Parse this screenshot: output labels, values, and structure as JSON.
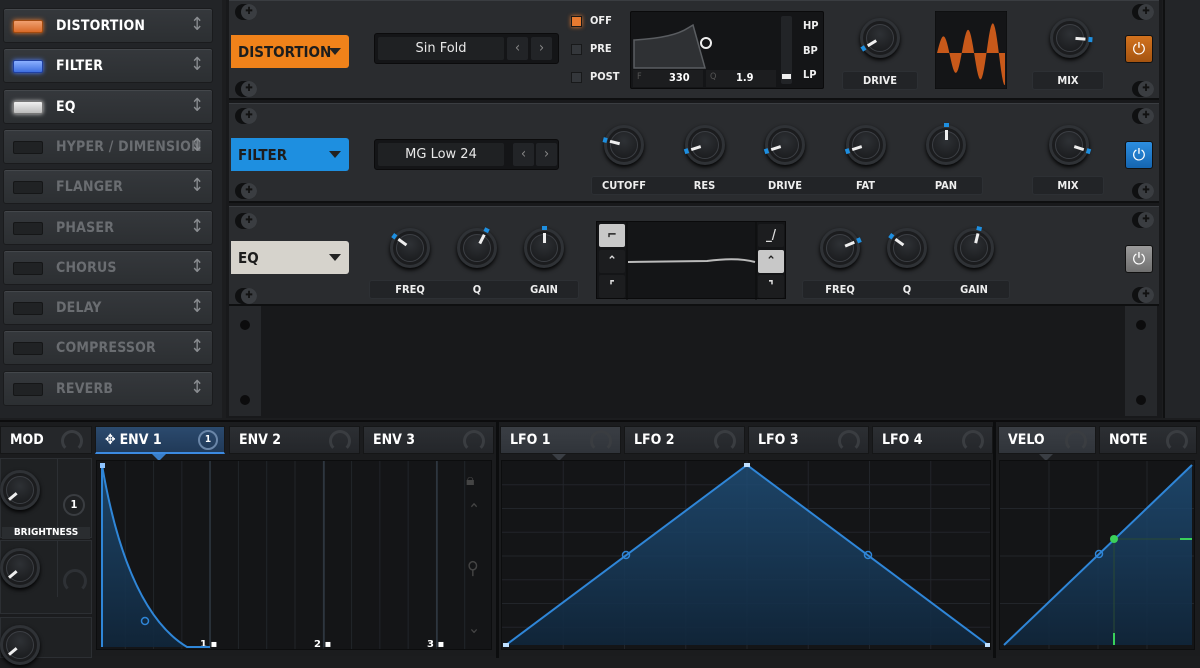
{
  "sidebar": {
    "items": [
      {
        "label": "DISTORTION",
        "state": "on",
        "led_color": "#e8792f"
      },
      {
        "label": "FILTER",
        "state": "on",
        "led_color": "#4f7df0"
      },
      {
        "label": "EQ",
        "state": "on",
        "led_color": "#dddddd"
      },
      {
        "label": "HYPER / DIMENSION",
        "state": "off"
      },
      {
        "label": "FLANGER",
        "state": "off"
      },
      {
        "label": "PHASER",
        "state": "off"
      },
      {
        "label": "CHORUS",
        "state": "off"
      },
      {
        "label": "DELAY",
        "state": "off"
      },
      {
        "label": "COMPRESSOR",
        "state": "off"
      },
      {
        "label": "REVERB",
        "state": "off"
      }
    ],
    "drag_icon": "↕"
  },
  "distortion": {
    "title": "DISTORTION",
    "color": "#f0821a",
    "preset": "Sin Fold",
    "prev": "‹",
    "next": "›",
    "routing": [
      {
        "label": "OFF",
        "checked": true
      },
      {
        "label": "PRE",
        "checked": false
      },
      {
        "label": "POST",
        "checked": false
      }
    ],
    "filter_display": {
      "f_label": "F",
      "f_value": "330",
      "q_label": "Q",
      "q_value": "1.9",
      "modes": [
        "HP",
        "BP",
        "LP"
      ],
      "selected_mode": "LP"
    },
    "knobs": [
      {
        "label": "DRIVE",
        "value": 0.05
      }
    ],
    "mix": {
      "label": "MIX",
      "value": 0.85
    },
    "power_icon": "⏻",
    "enabled": true
  },
  "filter": {
    "title": "FILTER",
    "color": "#1e8fe0",
    "preset": "MG Low 24",
    "prev": "‹",
    "next": "›",
    "knobs": [
      {
        "label": "CUTOFF",
        "value": 0.22
      },
      {
        "label": "RES",
        "value": 0.1
      },
      {
        "label": "DRIVE",
        "value": 0.1
      },
      {
        "label": "FAT",
        "value": 0.1
      },
      {
        "label": "PAN",
        "value": 0.5
      }
    ],
    "mix": {
      "label": "MIX",
      "value": 0.9
    },
    "power_icon": "⏻",
    "enabled": true
  },
  "eq": {
    "title": "EQ",
    "color": "#d6d3cc",
    "low": [
      {
        "label": "FREQ",
        "value": 0.3
      },
      {
        "label": "Q",
        "value": 0.6
      },
      {
        "label": "GAIN",
        "value": 0.5
      }
    ],
    "high": [
      {
        "label": "FREQ",
        "value": 0.75
      },
      {
        "label": "Q",
        "value": 0.3
      },
      {
        "label": "GAIN",
        "value": 0.55
      }
    ],
    "left_shapes": [
      "low-shelf",
      "peak",
      "high-pass"
    ],
    "right_shapes": [
      "high-shelf",
      "peak",
      "low-pass"
    ],
    "power_icon": "⏻",
    "enabled": true
  },
  "mod": {
    "header": "MOD",
    "source": {
      "label": "BRIGHTNESS",
      "count": "1"
    },
    "env_tabs": [
      {
        "label": "ENV 1",
        "active": true,
        "badge": "1"
      },
      {
        "label": "ENV 2",
        "active": false
      },
      {
        "label": "ENV 3",
        "active": false
      }
    ],
    "env_markers": [
      "1",
      "2",
      "3"
    ],
    "lfo_tabs": [
      {
        "label": "LFO 1",
        "selected": true
      },
      {
        "label": "LFO 2"
      },
      {
        "label": "LFO 3"
      },
      {
        "label": "LFO 4"
      }
    ],
    "velo_tabs": [
      {
        "label": "VELO",
        "selected": true
      },
      {
        "label": "NOTE"
      }
    ],
    "side_icons": [
      "lock-icon",
      "chevron-up-icon",
      "zoom-icon",
      "chevron-down-icon"
    ]
  }
}
